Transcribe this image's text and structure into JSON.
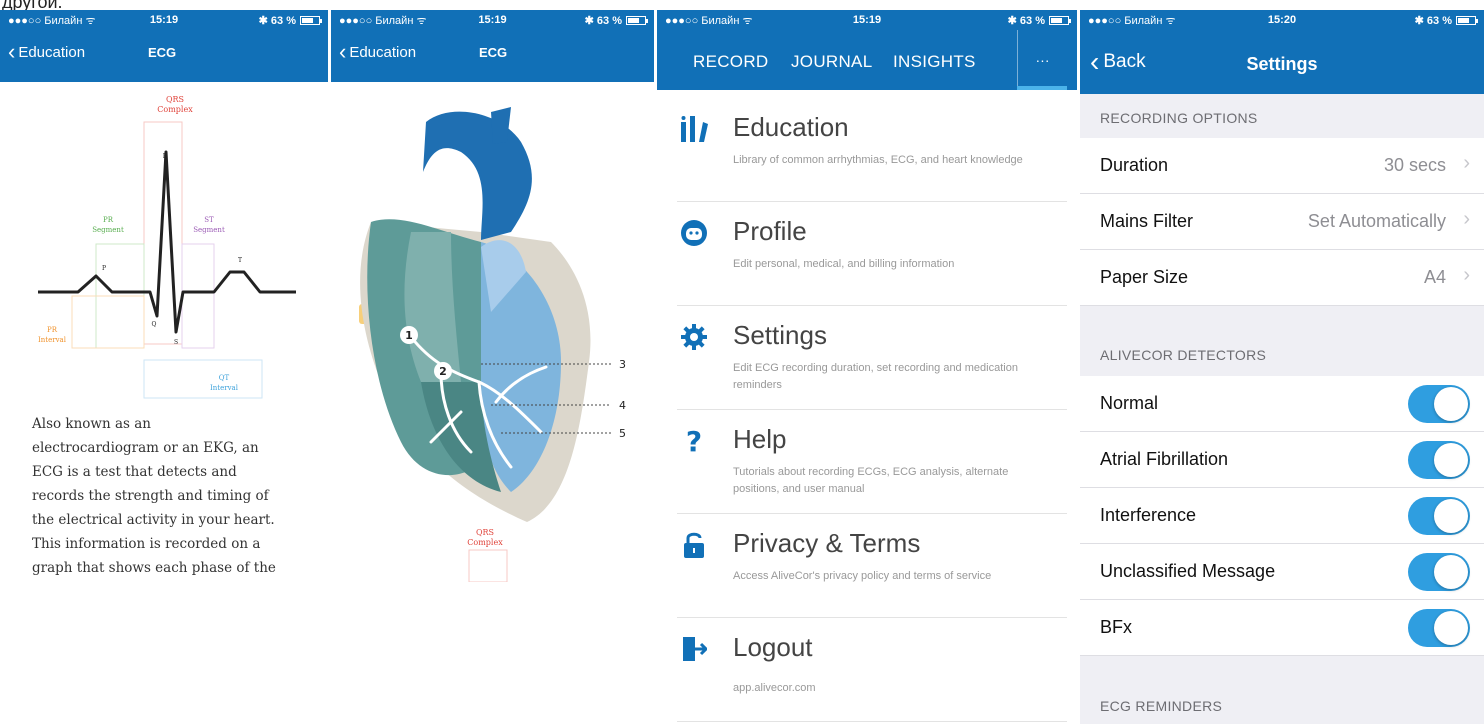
{
  "caption": "другой.",
  "colors": {
    "brand": "#1170b7",
    "toggle_on": "#2f9ee0"
  },
  "panel1": {
    "status": {
      "carrier": "●●●○○ Билайн ᯤ",
      "time": "15:19",
      "battery": "✱ 63 %"
    },
    "back_label": "Education",
    "title": "ECG",
    "diagram": {
      "qrs": [
        "QRS",
        "Complex"
      ],
      "pr_segment": [
        "PR",
        "Segment"
      ],
      "st_segment": [
        "ST",
        "Segment"
      ],
      "pr_interval": [
        "PR",
        "Interval"
      ],
      "qt_interval": [
        "QT",
        "Interval"
      ],
      "wave_r": "R",
      "wave_p": "P",
      "wave_t": "T",
      "wave_q": "Q",
      "wave_s": "S"
    },
    "text_lines": [
      "Also known as an",
      "electrocardiogram or an EKG, an",
      "ECG is a test that detects and",
      "records the strength and timing of",
      "the electrical activity in your heart.",
      "This information is recorded on a",
      "graph that shows each phase of the"
    ]
  },
  "panel2": {
    "status": {
      "carrier": "●●●○○ Билайн ᯤ",
      "time": "15:19",
      "battery": "✱ 63 %"
    },
    "back_label": "Education",
    "title": "ECG",
    "markers": [
      "1",
      "2",
      "3",
      "4",
      "5"
    ],
    "qrs": [
      "QRS",
      "Complex"
    ]
  },
  "panel3": {
    "status": {
      "carrier": "●●●○○ Билайн ᯤ",
      "time": "15:19",
      "battery": "✱ 63 %"
    },
    "tabs": [
      "RECORD",
      "JOURNAL",
      "INSIGHTS"
    ],
    "more": "···",
    "items": [
      {
        "icon": "bar-chart-icon",
        "title": "Education",
        "desc": "Library of common arrhythmias, ECG, and heart knowledge"
      },
      {
        "icon": "face-icon",
        "title": "Profile",
        "desc": "Edit personal, medical, and billing information"
      },
      {
        "icon": "gear-icon",
        "title": "Settings",
        "desc": "Edit ECG recording duration, set recording and medication reminders"
      },
      {
        "icon": "question-icon",
        "title": "Help",
        "desc": "Tutorials about recording ECGs, ECG analysis, alternate positions, and user manual"
      },
      {
        "icon": "lock-icon",
        "title": "Privacy & Terms",
        "desc": "Access AliveCor's privacy policy and terms of service"
      },
      {
        "icon": "logout-icon",
        "title": "Logout",
        "desc": "app.alivecor.com"
      }
    ]
  },
  "panel4": {
    "status": {
      "carrier": "●●●○○ Билайн ᯤ",
      "time": "15:20",
      "battery": "✱ 63 %"
    },
    "back_label": "Back",
    "title": "Settings",
    "recording_header": "RECORDING OPTIONS",
    "recording_rows": [
      {
        "label": "Duration",
        "value": "30 secs"
      },
      {
        "label": "Mains Filter",
        "value": "Set Automatically"
      },
      {
        "label": "Paper Size",
        "value": "A4"
      }
    ],
    "detectors_header": "ALIVECOR DETECTORS",
    "detectors": [
      {
        "label": "Normal",
        "on": true
      },
      {
        "label": "Atrial Fibrillation",
        "on": true
      },
      {
        "label": "Interference",
        "on": true
      },
      {
        "label": "Unclassified Message",
        "on": true
      },
      {
        "label": "BFx",
        "on": true
      }
    ],
    "reminders_header": "ECG REMINDERS"
  }
}
